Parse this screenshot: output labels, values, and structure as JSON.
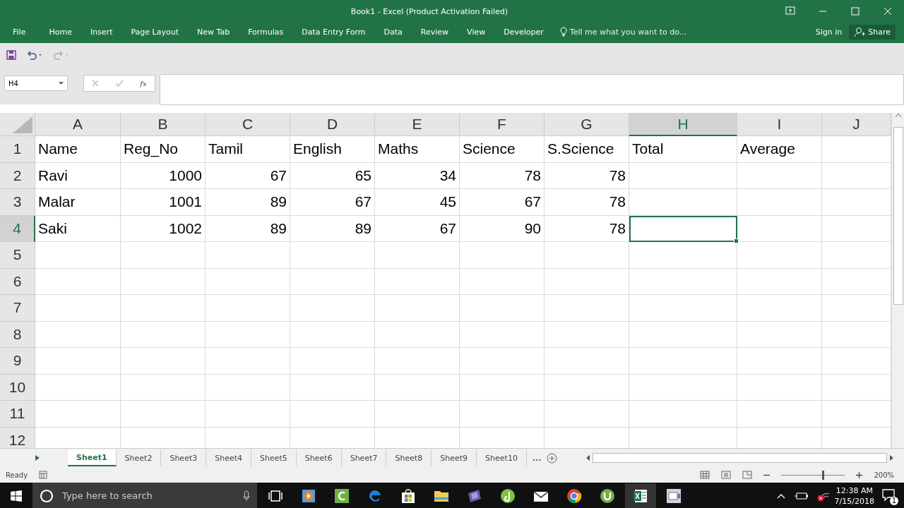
{
  "window": {
    "title": "Book1 - Excel (Product Activation Failed)"
  },
  "ribbon": {
    "tabs": [
      {
        "label": "File",
        "selected": false
      },
      {
        "label": "Home",
        "selected": false
      },
      {
        "label": "Insert",
        "selected": false
      },
      {
        "label": "Page Layout",
        "selected": false
      },
      {
        "label": "New Tab",
        "selected": false
      },
      {
        "label": "Formulas",
        "selected": false
      },
      {
        "label": "Data Entry Form",
        "selected": false
      },
      {
        "label": "Data",
        "selected": false
      },
      {
        "label": "Review",
        "selected": false
      },
      {
        "label": "View",
        "selected": false
      },
      {
        "label": "Developer",
        "selected": false
      }
    ],
    "tell_me": "Tell me what you want to do...",
    "sign_in": "Sign in",
    "share": "Share"
  },
  "formula_bar": {
    "name_box": "H4",
    "fx": "fx"
  },
  "sheet": {
    "columns": [
      {
        "label": "A",
        "selected": false
      },
      {
        "label": "B",
        "selected": false
      },
      {
        "label": "C",
        "selected": false
      },
      {
        "label": "D",
        "selected": false
      },
      {
        "label": "E",
        "selected": false
      },
      {
        "label": "F",
        "selected": false
      },
      {
        "label": "G",
        "selected": false
      },
      {
        "label": "H",
        "selected": true
      },
      {
        "label": "I",
        "selected": false
      },
      {
        "label": "J",
        "selected": false
      }
    ],
    "rows": [
      {
        "number": "1",
        "selected": false,
        "cells": [
          "Name",
          "Reg_No",
          "Tamil",
          "English",
          "Maths",
          "Science",
          "S.Science",
          "Total",
          "Average"
        ]
      },
      {
        "number": "2",
        "selected": false,
        "cells": [
          "Ravi",
          "1000",
          "67",
          "65",
          "34",
          "78",
          "78"
        ]
      },
      {
        "number": "3",
        "selected": false,
        "cells": [
          "Malar",
          "1001",
          "89",
          "67",
          "45",
          "67",
          "78"
        ]
      },
      {
        "number": "4",
        "selected": true,
        "cells": [
          "Saki",
          "1002",
          "89",
          "89",
          "67",
          "90",
          "78"
        ]
      },
      {
        "number": "5",
        "selected": false,
        "cells": []
      },
      {
        "number": "6",
        "selected": false,
        "cells": []
      },
      {
        "number": "7",
        "selected": false,
        "cells": []
      },
      {
        "number": "8",
        "selected": false,
        "cells": []
      },
      {
        "number": "9",
        "selected": false,
        "cells": []
      },
      {
        "number": "10",
        "selected": false,
        "cells": []
      },
      {
        "number": "11",
        "selected": false,
        "cells": []
      },
      {
        "number": "12",
        "selected": false,
        "cells": []
      }
    ]
  },
  "sheet_tabs": [
    {
      "label": "Sheet1",
      "selected": true
    },
    {
      "label": "Sheet2",
      "selected": false
    },
    {
      "label": "Sheet3",
      "selected": false
    },
    {
      "label": "Sheet4",
      "selected": false
    },
    {
      "label": "Sheet5",
      "selected": false
    },
    {
      "label": "Sheet6",
      "selected": false
    },
    {
      "label": "Sheet7",
      "selected": false
    },
    {
      "label": "Sheet8",
      "selected": false
    },
    {
      "label": "Sheet9",
      "selected": false
    },
    {
      "label": "Sheet10",
      "selected": false
    }
  ],
  "more_sheets": "...",
  "status_bar": {
    "status": "Ready",
    "zoom": {
      "level": 0.65
    },
    "zoom_reading": "200%"
  },
  "taskbar": {
    "search_placeholder": "Type here to search",
    "time": "12:38 AM",
    "date": "7/15/2018",
    "notifications": "1"
  }
}
